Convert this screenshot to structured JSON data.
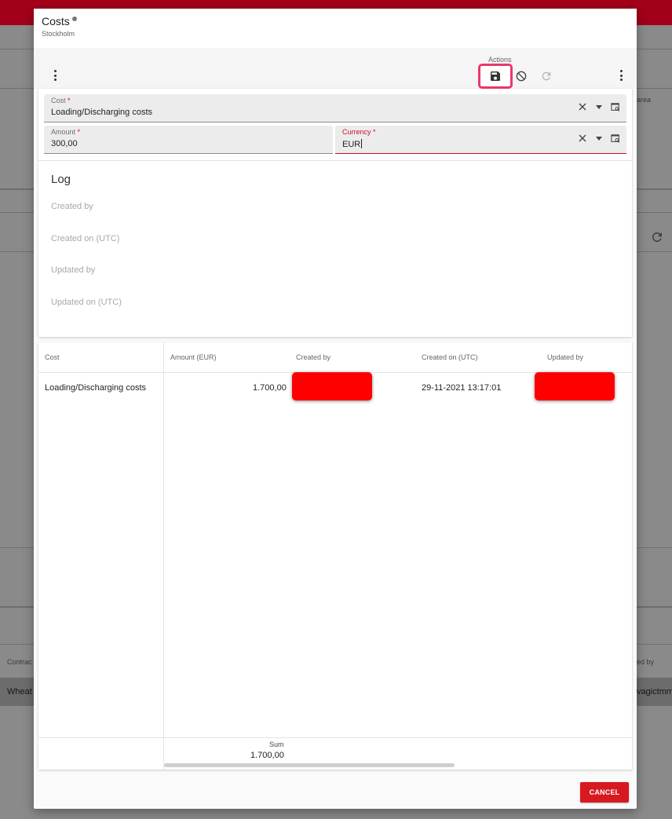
{
  "background": {
    "fragments": {
      "area_label": "area",
      "contract_header": "Contrac",
      "created_by_header": "ed by",
      "row_wheat": "Wheat",
      "row_user": "vagictmm"
    }
  },
  "dialog": {
    "title": "Costs",
    "subtitle": "Stockholm",
    "toolbar": {
      "actions_label": "Actions",
      "icons": [
        "save-icon",
        "cancel-circle-icon",
        "refresh-icon"
      ]
    },
    "form": {
      "cost": {
        "label": "Cost",
        "required_mark": "*",
        "value": "Loading/Discharging costs"
      },
      "amount": {
        "label": "Amount",
        "required_mark": "*",
        "value": "300,00"
      },
      "currency": {
        "label": "Currency",
        "required_mark": "*",
        "value": "EUR"
      }
    },
    "log": {
      "title": "Log",
      "created_by_label": "Created by",
      "created_on_label": "Created on (UTC)",
      "updated_by_label": "Updated by",
      "updated_on_label": "Updated on (UTC)"
    },
    "grid": {
      "headers": {
        "cost": "Cost",
        "amount": "Amount (EUR)",
        "created_by": "Created by",
        "created_on": "Created on (UTC)",
        "updated_by": "Updated by"
      },
      "rows": [
        {
          "cost": "Loading/Discharging costs",
          "amount": "1.700,00",
          "created_on": "29-11-2021 13:17:01"
        }
      ],
      "footer": {
        "sum_label": "Sum",
        "sum_value": "1.700,00"
      }
    },
    "cancel_label": "CANCEL"
  },
  "colors": {
    "brand_red": "#d71920",
    "required": "#c8102e",
    "highlight": "#e8396a",
    "redaction": "#ff0000"
  }
}
